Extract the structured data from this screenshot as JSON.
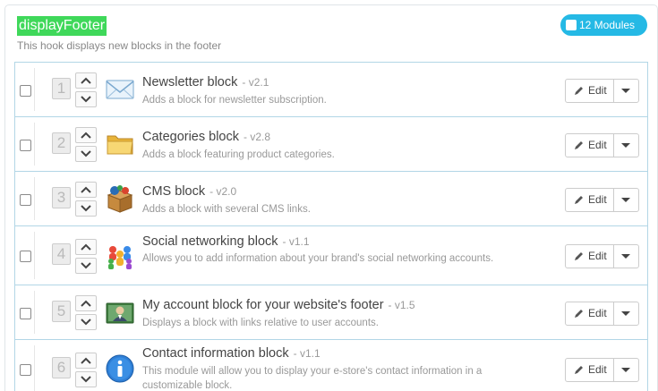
{
  "hook": {
    "name": "displayFooter",
    "description": "This hook displays new blocks in the footer",
    "module_count_label": "12 Modules"
  },
  "modules": [
    {
      "position": "1",
      "name": "Newsletter block",
      "version": "- v2.1",
      "description": "Adds a block for newsletter subscription.",
      "icon": "envelope-icon",
      "edit_label": "Edit"
    },
    {
      "position": "2",
      "name": "Categories block",
      "version": "- v2.8",
      "description": "Adds a block featuring product categories.",
      "icon": "folder-icon",
      "edit_label": "Edit"
    },
    {
      "position": "3",
      "name": "CMS block",
      "version": "- v2.0",
      "description": "Adds a block with several CMS links.",
      "icon": "cms-box-icon",
      "edit_label": "Edit"
    },
    {
      "position": "4",
      "name": "Social networking block",
      "version": "- v1.1",
      "description": "Allows you to add information about your brand's social networking accounts.",
      "icon": "social-network-icon",
      "edit_label": "Edit"
    },
    {
      "position": "5",
      "name": "My account block for your website's footer",
      "version": "- v1.5",
      "description": "Displays a block with links relative to user accounts.",
      "icon": "user-account-icon",
      "edit_label": "Edit"
    },
    {
      "position": "6",
      "name": "Contact information block",
      "version": "- v1.1",
      "description": "This module will allow you to display your e-store's contact information in a customizable block.",
      "icon": "info-icon",
      "edit_label": "Edit"
    }
  ]
}
